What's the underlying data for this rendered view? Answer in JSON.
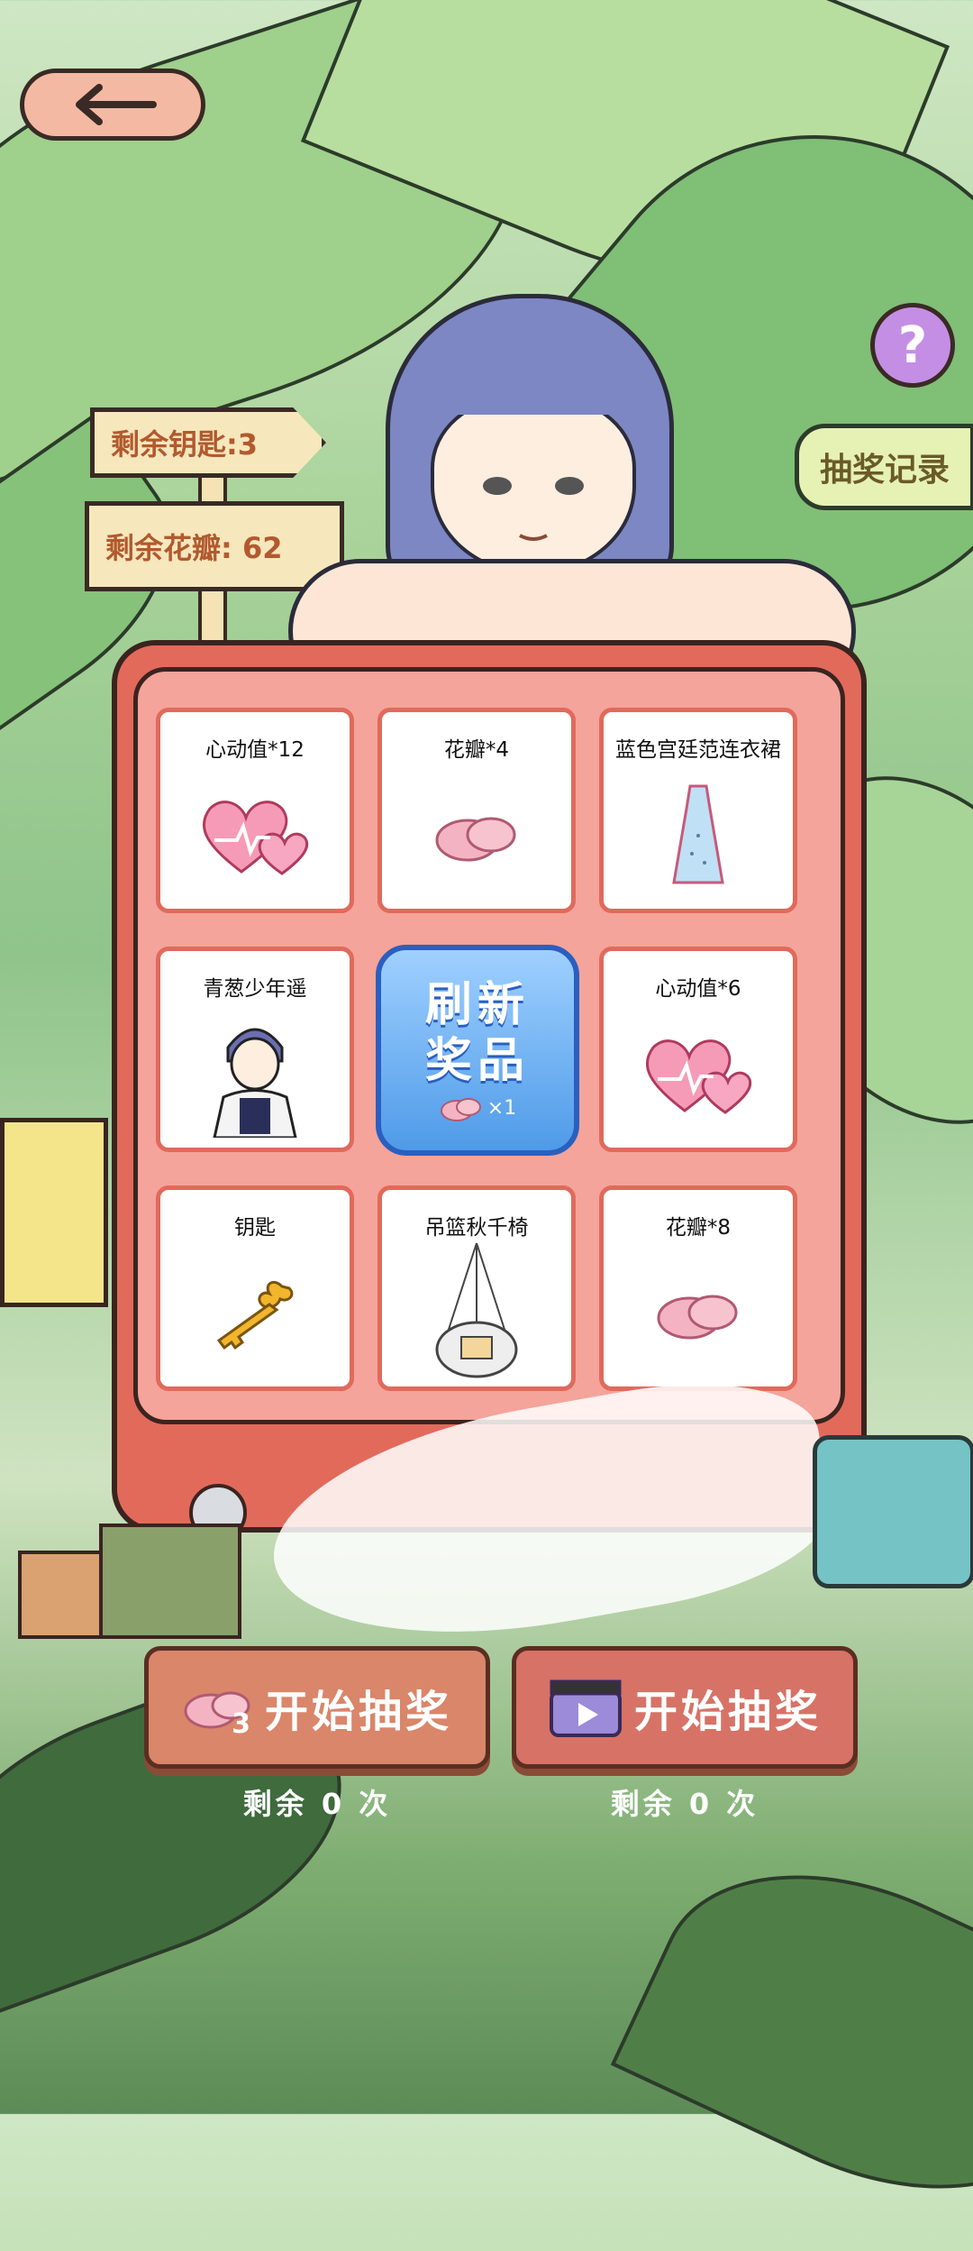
{
  "header": {
    "back_label": "back"
  },
  "help": {
    "label": "?"
  },
  "record_button": {
    "label": "抽奖记录"
  },
  "signs": {
    "keys": "剩余钥匙:3",
    "petals": "剩余花瓣: 62"
  },
  "grid": {
    "items": [
      {
        "label": "心动值*12",
        "icon": "heart-icon"
      },
      {
        "label": "花瓣*4",
        "icon": "petal-icon"
      },
      {
        "label": "蓝色宫廷范连衣裙",
        "icon": "dress-icon"
      },
      {
        "label": "青葱少年遥",
        "icon": "boy-avatar-icon"
      },
      {
        "label": "心动值*6",
        "icon": "heart-icon"
      },
      {
        "label": "钥匙",
        "icon": "key-icon"
      },
      {
        "label": "吊篮秋千椅",
        "icon": "swing-chair-icon"
      },
      {
        "label": "花瓣*8",
        "icon": "petal-icon"
      }
    ],
    "refresh": {
      "line1": "刷新",
      "line2": "奖品",
      "cost": "×1"
    }
  },
  "buttons": {
    "petal_draw": {
      "label": "开始抽奖",
      "cost": "3",
      "remain": "剩余 0 次"
    },
    "video_draw": {
      "label": "开始抽奖",
      "remain": "剩余 0 次"
    }
  },
  "colors": {
    "machine": "#e26a5b",
    "panel": "#f4a49a",
    "refresh": "#4f9be8",
    "help": "#c58ee5"
  }
}
